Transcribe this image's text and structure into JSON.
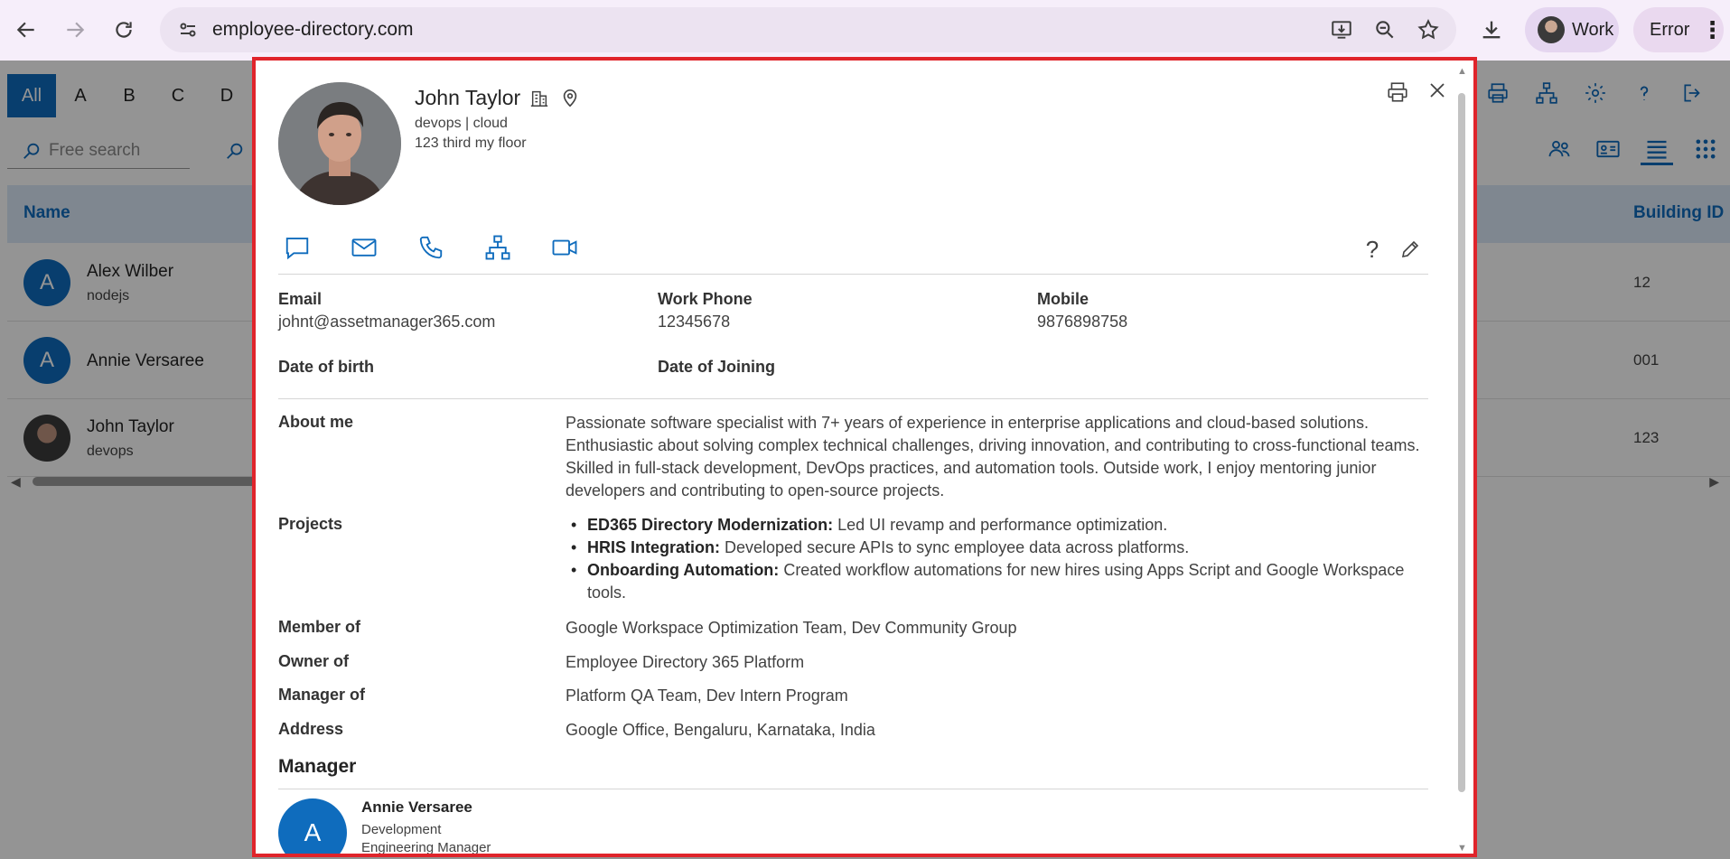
{
  "browser": {
    "url": "employee-directory.com",
    "profile_label": "Work",
    "error_label": "Error"
  },
  "app": {
    "alphabet": [
      "All",
      "A",
      "B",
      "C",
      "D"
    ],
    "search_placeholder": "Free search",
    "columns": {
      "name": "Name",
      "building": "Building ID"
    },
    "rows": [
      {
        "initial": "A",
        "name": "Alex Wilber",
        "sub": "nodejs",
        "building": "12"
      },
      {
        "initial": "A",
        "name": "Annie Versaree",
        "sub": "",
        "building": "001"
      },
      {
        "initial": "",
        "name": "John Taylor",
        "sub": "devops",
        "building": "123"
      }
    ]
  },
  "profile": {
    "name": "John Taylor",
    "dept": "devops | cloud",
    "location": "123 third my floor",
    "fields": {
      "email_label": "Email",
      "email_value": "johnt@assetmanager365.com",
      "work_phone_label": "Work Phone",
      "work_phone_value": "12345678",
      "mobile_label": "Mobile",
      "mobile_value": "9876898758",
      "dob_label": "Date of birth",
      "doj_label": "Date of Joining"
    },
    "about_label": "About me",
    "about_value": "Passionate software specialist with 7+ years of experience in enterprise applications and cloud-based solutions. Enthusiastic about solving complex technical challenges, driving innovation, and contributing to cross-functional teams. Skilled in full-stack development, DevOps practices, and automation tools. Outside work, I enjoy mentoring junior developers and contributing to open-source projects.",
    "projects_label": "Projects",
    "projects": [
      {
        "title": "ED365 Directory Modernization:",
        "desc": " Led UI revamp and performance optimization."
      },
      {
        "title": "HRIS Integration:",
        "desc": " Developed secure APIs to sync employee data across platforms."
      },
      {
        "title": "Onboarding Automation:",
        "desc": " Created workflow automations for new hires using Apps Script and Google Workspace tools."
      }
    ],
    "member_label": "Member of",
    "member_value": "Google Workspace Optimization Team, Dev Community Group",
    "owner_label": "Owner of",
    "owner_value": "Employee Directory 365 Platform",
    "manager_of_label": "Manager of",
    "manager_of_value": "Platform QA Team, Dev Intern Program",
    "address_label": "Address",
    "address_value": "Google Office, Bengaluru, Karnataka, India",
    "manager_section_title": "Manager",
    "manager": {
      "initial": "A",
      "name": "Annie Versaree",
      "dept": "Development",
      "role": "Engineering Manager"
    }
  }
}
